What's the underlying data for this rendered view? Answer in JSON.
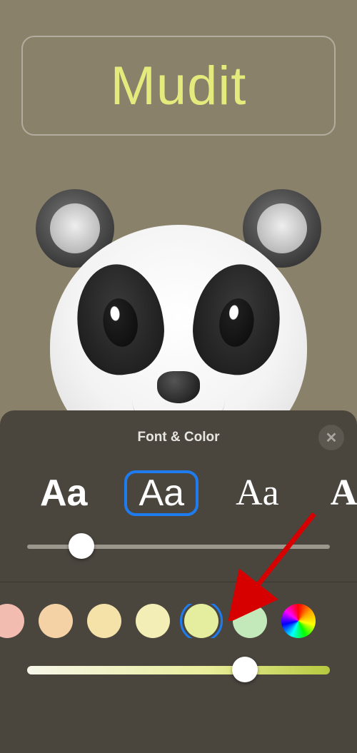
{
  "contact": {
    "name": "Mudit",
    "name_color": "#e5ea7c"
  },
  "panel": {
    "title": "Font & Color",
    "close_label": "✕",
    "fonts": {
      "sample": "Aa",
      "options": [
        "f1",
        "f2",
        "f3",
        "f4"
      ],
      "selected_index": 1
    },
    "size_slider": {
      "value_pct": 18
    },
    "colors": {
      "options": [
        {
          "hex": "#f2bcb1"
        },
        {
          "hex": "#f5d2a6"
        },
        {
          "hex": "#f4e2a9"
        },
        {
          "hex": "#f3edb6"
        },
        {
          "hex": "#e4ee9e"
        },
        {
          "hex": "#c3e8b9"
        }
      ],
      "selected_index": 4,
      "picker_label": "custom-color"
    },
    "tint_slider": {
      "value_pct": 72
    }
  }
}
